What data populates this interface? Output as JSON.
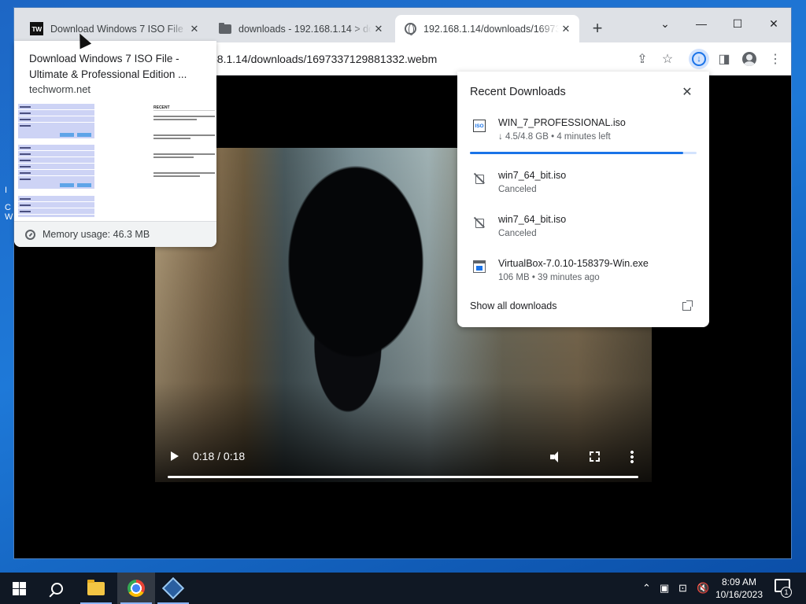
{
  "browser": {
    "tabs": [
      {
        "title": "Download Windows 7 ISO File - Ultimate & Professional Edition",
        "favicon": "tw-icon"
      },
      {
        "title": "downloads - 192.168.1.14 > downloads",
        "favicon": "folder-icon"
      },
      {
        "title": "192.168.1.14/downloads/1697337129881332.webm",
        "favicon": "globe-icon"
      }
    ],
    "window_controls": {
      "minimize": "—",
      "maximize": "☐",
      "close": "✕",
      "tab_list": "⌄"
    },
    "new_tab_label": "+",
    "address": {
      "partial_url": "68.1.14/downloads/1697337129881332.webm"
    },
    "toolbar_icons": [
      "share-icon",
      "star-icon",
      "download-icon",
      "side-panel-icon",
      "profile-icon",
      "kebab-menu-icon"
    ]
  },
  "hover_card": {
    "title": "Download Windows 7 ISO File -Ultimate & Professional Edition ...",
    "domain": "techworm.net",
    "thumbnail_recent_heading": "RECENT",
    "memory_usage": "Memory usage: 46.3 MB"
  },
  "video": {
    "time": "0:18 / 0:18",
    "progress": 1.0
  },
  "downloads": {
    "header": "Recent Downloads",
    "items": [
      {
        "name": "WIN_7_PROFESSIONAL.iso",
        "status": "↓ 4.5/4.8 GB • 4 minutes left",
        "icon": "iso-file-icon",
        "progress": 0.94
      },
      {
        "name": "win7_64_bit.iso",
        "status": "Canceled",
        "icon": "canceled-file-icon"
      },
      {
        "name": "win7_64_bit.iso",
        "status": "Canceled",
        "icon": "canceled-file-icon"
      },
      {
        "name": "VirtualBox-7.0.10-158379-Win.exe",
        "status": "106 MB • 39 minutes ago",
        "icon": "exe-file-icon"
      }
    ],
    "show_all": "Show all downloads"
  },
  "taskbar": {
    "apps": [
      "start-button",
      "search-button",
      "file-explorer",
      "chrome",
      "virtualbox"
    ],
    "clock_time": "8:09 AM",
    "clock_date": "10/16/2023",
    "notification_count": "1"
  },
  "desktop_text": [
    "I",
    "C",
    "W"
  ],
  "colors": {
    "accent": "#1a73e8",
    "taskbar": "#101824",
    "desktop": "#1e6fc9"
  }
}
